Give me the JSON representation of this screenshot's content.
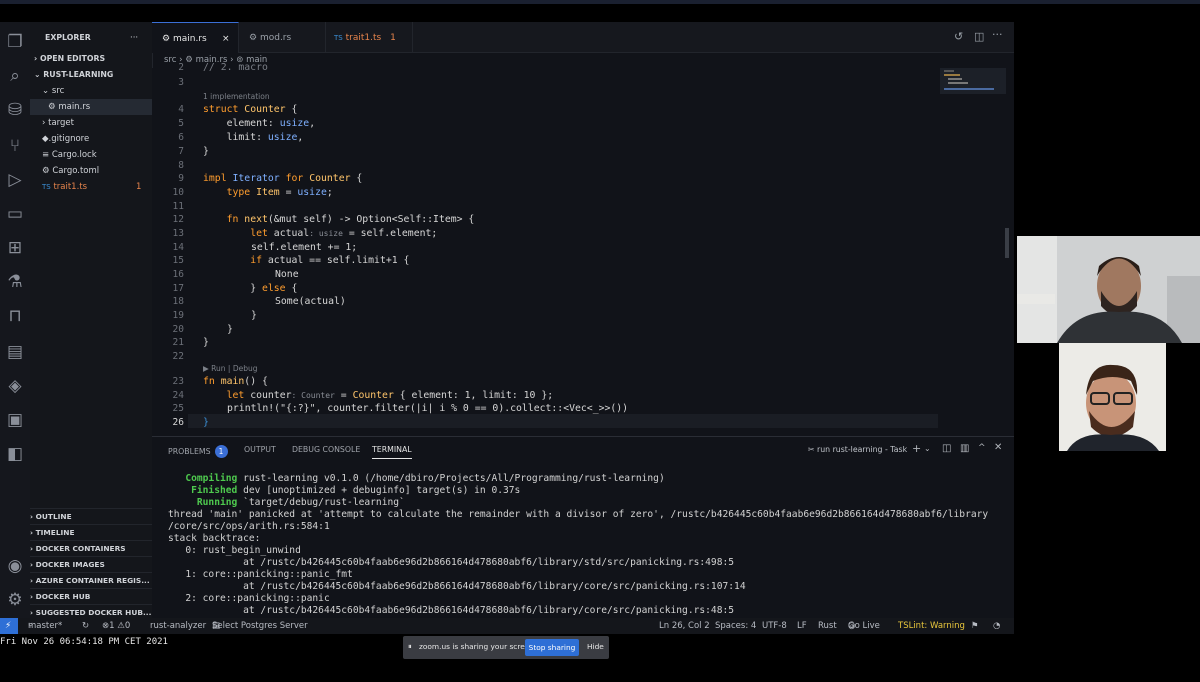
{
  "explorer": {
    "title": "EXPLORER",
    "more": "···",
    "open_editors": "OPEN EDITORS",
    "project": "RUST-LEARNING",
    "tree": [
      {
        "label": "src",
        "arrow": "⌄"
      },
      {
        "label": "main.rs"
      },
      {
        "label": "target",
        "arrow": "›"
      },
      {
        "label": ".gitignore"
      },
      {
        "label": "Cargo.lock"
      },
      {
        "label": "Cargo.toml"
      },
      {
        "label": "trait1.ts",
        "badge": "1"
      }
    ],
    "sections": [
      "OUTLINE",
      "TIMELINE",
      "DOCKER CONTAINERS",
      "DOCKER IMAGES",
      "AZURE CONTAINER REGIS...",
      "DOCKER HUB",
      "SUGGESTED DOCKER HUB..."
    ]
  },
  "tabs": [
    {
      "label": "main.rs",
      "close": "×"
    },
    {
      "label": "mod.rs"
    },
    {
      "label": "trait1.ts",
      "prefix": "TS",
      "badge": "1"
    }
  ],
  "breadcrumb": {
    "folder": "src",
    "sep1": "›",
    "file": "main.rs",
    "sep2": "›",
    "symbol": "main"
  },
  "editor": {
    "lens_impl": "1 implementation",
    "lens_run": "▶ Run | Debug",
    "line_numbers": [
      "2",
      "3",
      "4",
      "5",
      "6",
      "7",
      "8",
      "9",
      "10",
      "11",
      "12",
      "13",
      "14",
      "15",
      "16",
      "17",
      "18",
      "19",
      "20",
      "21",
      "22",
      "23",
      "24",
      "25",
      "26"
    ],
    "code": {
      "l2": "// 2. macro",
      "l4_kw": "struct",
      "l4_name": "Counter",
      "l4_rest": " {",
      "l5_field": "element",
      "l5_type": "usize",
      "l6_field": "limit",
      "l6_type": "usize",
      "l7": "}",
      "l9_kw": "impl",
      "l9_trait": "Iterator",
      "l9_for": "for",
      "l9_name": "Counter",
      "l9_rest": " {",
      "l10_kw": "type",
      "l10_name": "Item",
      "l10_type": "usize",
      "l12_kw": "fn",
      "l12_name": "next",
      "l12_rest": "(&mut self) -> Option<Self::Item> {",
      "l13_kw": "let",
      "l13_var": "actual",
      "l13_hint": "usize",
      "l13_rest": " = self.element;",
      "l14": "self.element += 1;",
      "l15_kw": "if",
      "l15_rest": " actual == self.limit+1 {",
      "l16": "None",
      "l17_close": "} ",
      "l17_kw": "else",
      "l17_rest": " {",
      "l18": "Some(actual)",
      "l19": "}",
      "l20": "}",
      "l21": "}",
      "l23_kw": "fn",
      "l23_name": "main",
      "l23_rest": "() {",
      "l24_kw": "let",
      "l24_var": "counter",
      "l24_hint": "Counter",
      "l24_name": "Counter",
      "l24_rest": " { element: 1, limit: 10 };",
      "l25": "println!(\"{:?}\", counter.filter(|i| i % 0 == 0).collect::<Vec<_>>())",
      "l26": "}"
    }
  },
  "panel": {
    "tabs": [
      "PROBLEMS",
      "OUTPUT",
      "DEBUG CONSOLE",
      "TERMINAL"
    ],
    "problems_count": "1",
    "task": "run rust-learning - Task",
    "terminal": [
      {
        "lead": "   Compiling",
        "text": " rust-learning v0.1.0 (/home/dbiro/Projects/All/Programming/rust-learning)"
      },
      {
        "lead": "    Finished",
        "text": " dev [unoptimized + debuginfo] target(s) in 0.37s"
      },
      {
        "lead": "     Running",
        "text": " `target/debug/rust-learning`"
      },
      {
        "text": "thread 'main' panicked at 'attempt to calculate the remainder with a divisor of zero', /rustc/b426445c60b4faab6e96d2b866164d478680abf6/library"
      },
      {
        "text": "/core/src/ops/arith.rs:584:1"
      },
      {
        "text": "stack backtrace:"
      },
      {
        "text": "   0: rust_begin_unwind"
      },
      {
        "text": "             at /rustc/b426445c60b4faab6e96d2b866164d478680abf6/library/std/src/panicking.rs:498:5"
      },
      {
        "text": "   1: core::panicking::panic_fmt"
      },
      {
        "text": "             at /rustc/b426445c60b4faab6e96d2b866164d478680abf6/library/core/src/panicking.rs:107:14"
      },
      {
        "text": "   2: core::panicking::panic"
      },
      {
        "text": "             at /rustc/b426445c60b4faab6e96d2b866164d478680abf6/library/core/src/panicking.rs:48:5"
      }
    ]
  },
  "status": {
    "branch": "master*",
    "errors": "⊗1 ⚠0",
    "analyzer": "rust-analyzer",
    "postgres": "Select Postgres Server",
    "position": "Ln 26, Col 2",
    "spaces": "Spaces: 4",
    "encoding": "UTF-8",
    "eol": "LF",
    "language": "Rust",
    "golive": "Go Live",
    "tslint": "TSLint: Warning"
  },
  "clock": "Fri Nov 26 06:54:18 PM CET 2021",
  "zoom": {
    "sharing": "zoom.us is sharing your screen.",
    "stop": "Stop sharing",
    "hide": "Hide"
  }
}
